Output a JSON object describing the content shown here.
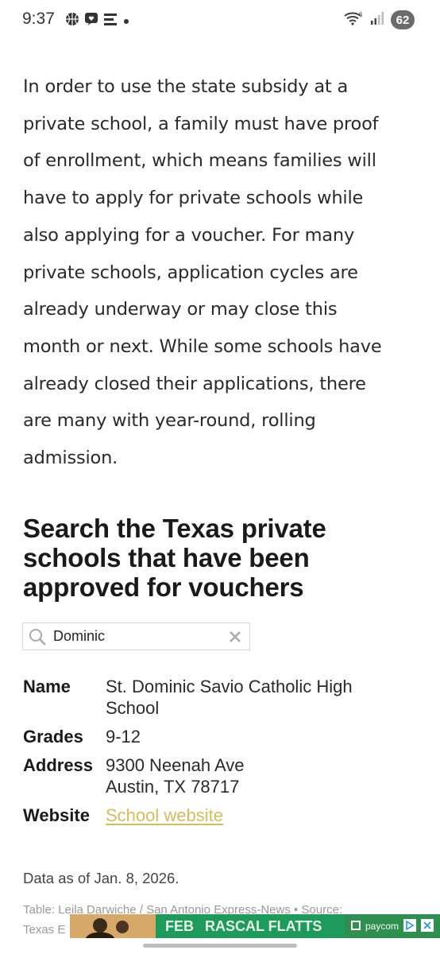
{
  "status_bar": {
    "time": "9:37",
    "battery": "62",
    "left_icons": [
      "basketball-icon",
      "heart-message-icon",
      "e-news-icon",
      "dot-icon"
    ],
    "right_icons": [
      "wifi-icon",
      "signal-icon",
      "battery-icon"
    ]
  },
  "article": {
    "lines": [
      "In order to use the state subsidy at a",
      "private school, a family must have proof",
      "of enrollment, which means families will",
      "have to apply for private schools while",
      "also applying for a voucher. For many",
      "private schools, application cycles are",
      "already underway or may close this",
      "month or next. While some schools have",
      "already closed their applications, there",
      "are many with year-round, rolling",
      "admission."
    ]
  },
  "section": {
    "heading_lines": [
      "Search the Texas private",
      "schools that have been",
      "approved for vouchers"
    ]
  },
  "search": {
    "value": "Dominic",
    "placeholder": ""
  },
  "result": {
    "name_label": "Name",
    "name_value": "St. Dominic Savio Catholic High School",
    "grades_label": "Grades",
    "grades_value": "9-12",
    "address_label": "Address",
    "address_line1": "9300 Neenah Ave",
    "address_line2": "Austin, TX 78717",
    "website_label": "Website",
    "website_link": "School website"
  },
  "footer": {
    "data_as_of": "Data as of Jan. 8, 2026.",
    "credit_line1": "Table: Leila Darwiche / San Antonio Express-News • Source:",
    "credit_line2": "Texas E"
  },
  "ad": {
    "mid_text": "FEB",
    "mid_text2": "RASCAL FLATTS",
    "right_text": "paycom"
  },
  "colors": {
    "link": "#d9bb5a",
    "ad_green": "#1e9a5b"
  }
}
